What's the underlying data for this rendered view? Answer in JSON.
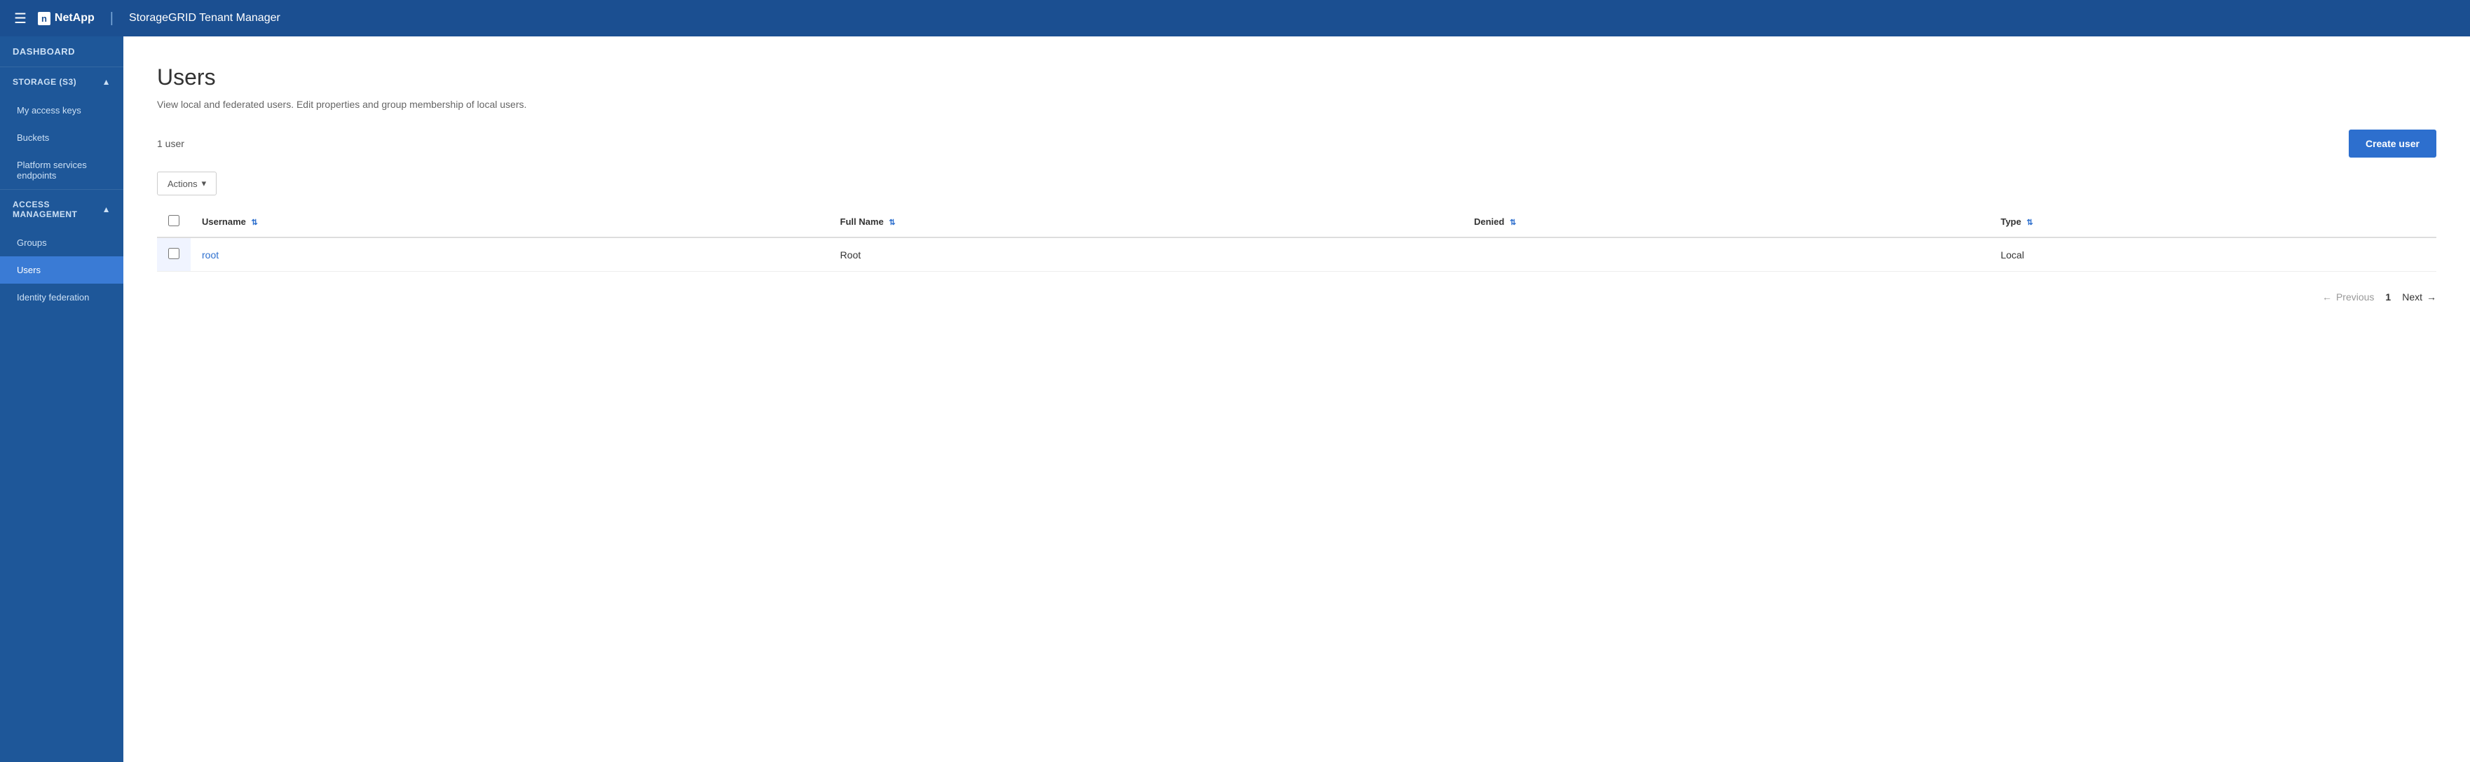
{
  "header": {
    "hamburger_label": "☰",
    "logo_text": "NetApp",
    "logo_box_text": "n",
    "divider": "|",
    "app_title": "StorageGRID Tenant Manager"
  },
  "sidebar": {
    "dashboard_label": "DASHBOARD",
    "storage_section_label": "STORAGE (S3)",
    "my_access_keys_label": "My access keys",
    "buckets_label": "Buckets",
    "platform_services_label": "Platform services endpoints",
    "access_management_label": "ACCESS MANAGEMENT",
    "groups_label": "Groups",
    "users_label": "Users",
    "identity_federation_label": "Identity federation"
  },
  "main": {
    "page_title": "Users",
    "page_description": "View local and federated users. Edit properties and group membership of local users.",
    "user_count_label": "1 user",
    "create_user_btn": "Create user",
    "actions_btn": "Actions",
    "table": {
      "columns": [
        "Username",
        "Full Name",
        "Denied",
        "Type"
      ],
      "rows": [
        {
          "username": "root",
          "full_name": "Root",
          "denied": "",
          "type": "Local"
        }
      ]
    },
    "pagination": {
      "previous_label": "Previous",
      "next_label": "Next",
      "current_page": "1",
      "left_arrow": "←",
      "right_arrow": "→"
    }
  }
}
